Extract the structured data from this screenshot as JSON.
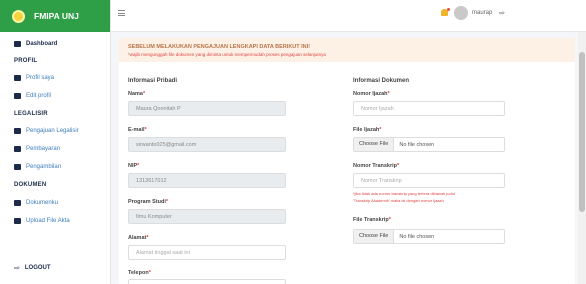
{
  "brand": {
    "name": "FMIPA UNJ"
  },
  "sidebar": {
    "items": [
      {
        "label": "Dashboard"
      },
      {
        "label": "Profil saya"
      },
      {
        "label": "Edit profil"
      },
      {
        "label": "Pengajuan Legalisir"
      },
      {
        "label": "Pembayaran"
      },
      {
        "label": "Pengambilan"
      },
      {
        "label": "Dokumenku"
      },
      {
        "label": "Upload File Akta"
      }
    ],
    "sections": {
      "profil": "PROFIL",
      "legalisir": "LEGALISIR",
      "dokumen": "DOKUMEN"
    },
    "logout": "LOGOUT"
  },
  "topbar": {
    "username": "maurap"
  },
  "alert": {
    "title": "SEBELUM MELAKUKAN PENGAJUAN LENGKAPI DATA BERIKUT INI!",
    "subtitle": "*wajib mengunggah file dokumen yang diminta untuk mempermudah proses pengajuan selanjutnya"
  },
  "left": {
    "title": "Informasi Pribadi",
    "nama_label": "Nama",
    "nama_value": "Maura Qoonitah P",
    "email_label": "E-mail",
    "email_value": "sirwanto025@gmail.com",
    "nip_label": "NIP",
    "nip_value": "1313617012",
    "prodi_label": "Program Studi",
    "prodi_value": "Ilmu Komputer",
    "alamat_label": "Alamat",
    "alamat_placeholder": "Alamat tinggal saat ini",
    "telepon_label": "Telepon"
  },
  "right": {
    "title": "Informasi Dokumen",
    "ijazah_label": "Nomor Ijazah",
    "ijazah_placeholder": "Nomor Ijazah",
    "file_ijazah_label": "File Ijazah",
    "transkrip_label": "Nomor Transkrip",
    "transkrip_placeholder": "Nomor Transkrip",
    "transkrip_note1": "*jika tidak ada nomor transkrip yang tertera dibawah judul",
    "transkrip_note2": "'Transkrip Akademik' maka isi dengan nomor ijazah",
    "file_transkrip_label": "File Transkrip",
    "choose_file": "Choose File",
    "no_file": "No file chosen"
  }
}
